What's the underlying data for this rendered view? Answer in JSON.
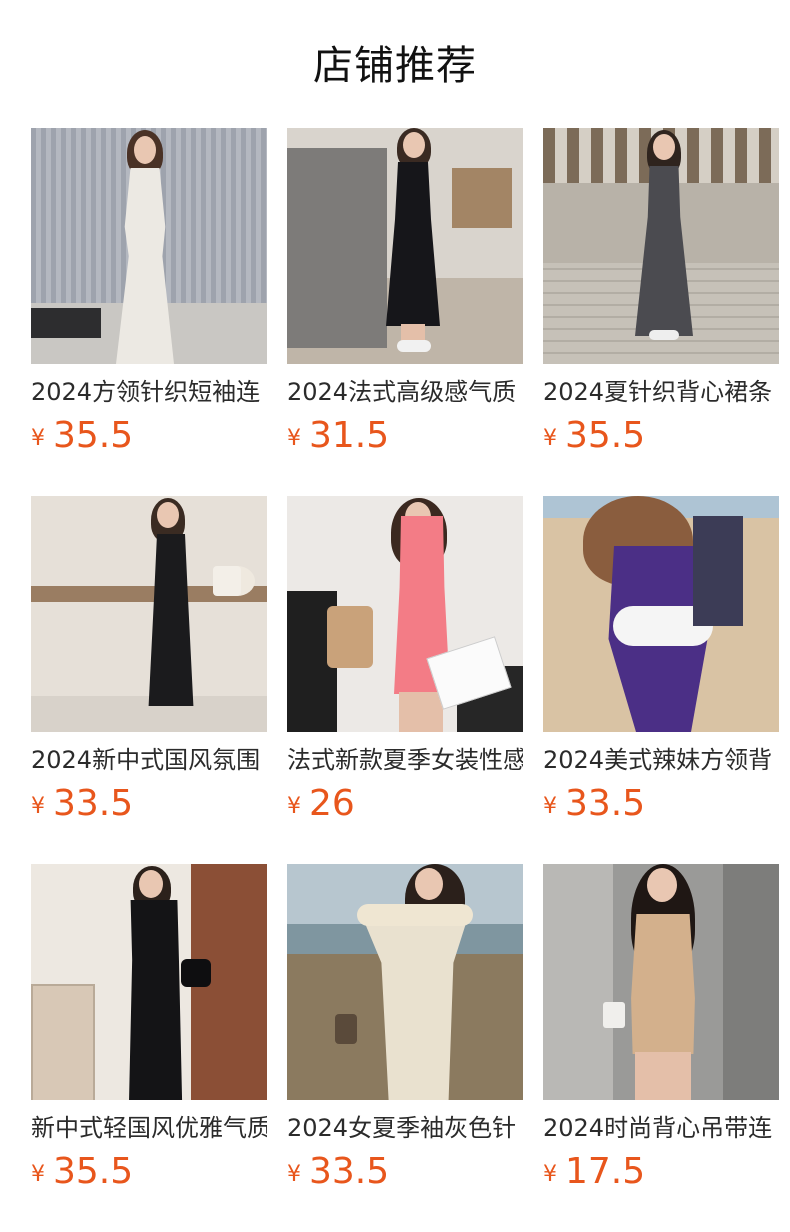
{
  "header": {
    "title": "店铺推荐"
  },
  "currency_symbol": "¥",
  "products": [
    {
      "name": "2024方领针织短袖连",
      "price": "35.5"
    },
    {
      "name": "2024法式高级感气质",
      "price": "31.5"
    },
    {
      "name": "2024夏针织背心裙条",
      "price": "35.5"
    },
    {
      "name": "2024新中式国风氛围",
      "price": "33.5"
    },
    {
      "name": "法式新款夏季女装性感",
      "price": "26"
    },
    {
      "name": "2024美式辣妹方领背",
      "price": "33.5"
    },
    {
      "name": "新中式轻国风优雅气质",
      "price": "35.5"
    },
    {
      "name": "2024女夏季袖灰色针",
      "price": "33.5"
    },
    {
      "name": "2024时尚背心吊带连",
      "price": "17.5"
    }
  ],
  "colors": {
    "price": "#e8561c",
    "title": "#111111"
  }
}
